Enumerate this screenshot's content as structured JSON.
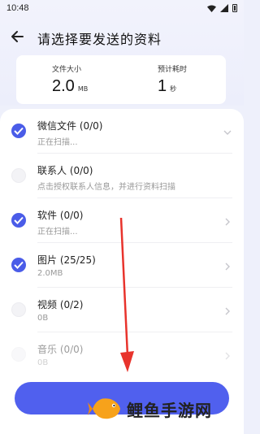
{
  "status_bar": {
    "time": "10:48"
  },
  "header": {
    "title": "请选择要发送的资料"
  },
  "stats": {
    "size_label": "文件大小",
    "size_value": "2.0",
    "size_unit": "MB",
    "time_label": "预计耗时",
    "time_value": "1",
    "time_unit": "秒"
  },
  "items": [
    {
      "title": "微信文件  (0/0)",
      "subtitle": "正在扫描...",
      "checked": true,
      "chevron": "down"
    },
    {
      "title": "联系人  (0/0)",
      "subtitle": "点击授权联系人信息，并进行资料扫描",
      "checked": false,
      "chevron": "none"
    },
    {
      "title": "软件  (0/0)",
      "subtitle": "正在扫描...",
      "checked": true,
      "chevron": "right"
    },
    {
      "title": "图片  (25/25)",
      "subtitle": "2.0MB",
      "checked": true,
      "chevron": "right"
    },
    {
      "title": "视频  (0/2)",
      "subtitle": "0B",
      "checked": false,
      "chevron": "right"
    },
    {
      "title": "音乐  (0/0)",
      "subtitle": "0B",
      "checked": false,
      "chevron": "right"
    }
  ],
  "send_button": {
    "label": ""
  },
  "watermark": {
    "text": "鲤鱼手游网"
  },
  "colors": {
    "accent": "#4a5ce8",
    "button": "#5060ee",
    "arrow": "#e8332c"
  }
}
